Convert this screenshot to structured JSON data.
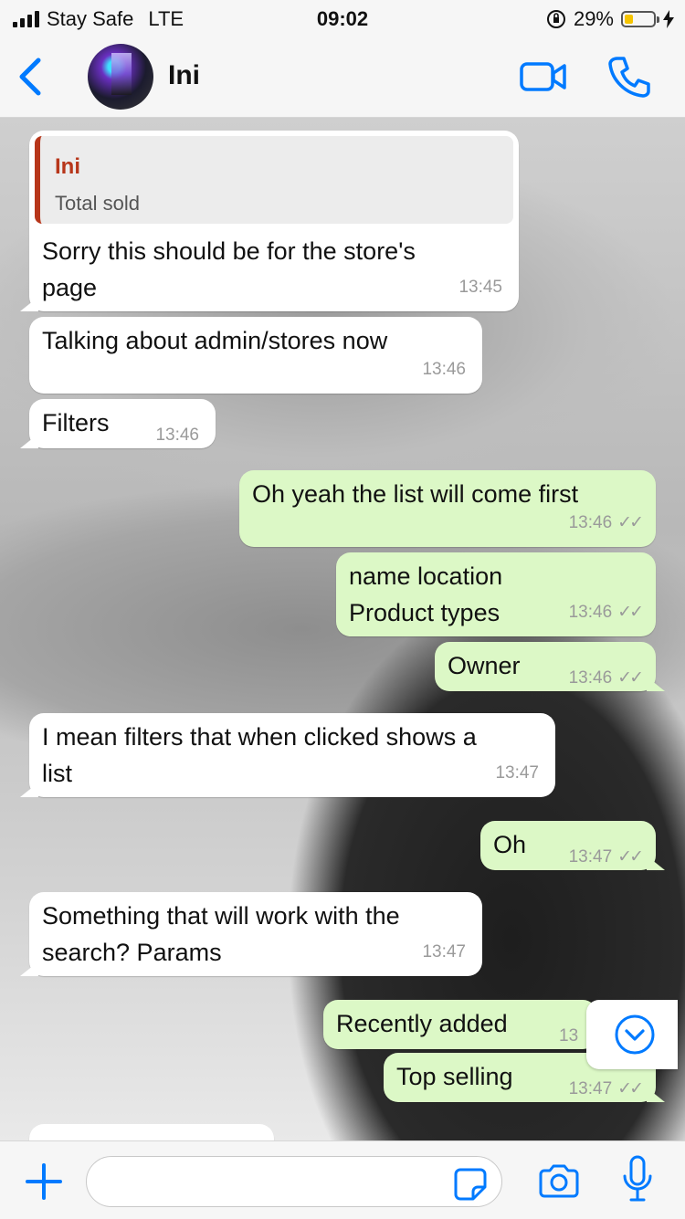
{
  "status_bar": {
    "carrier": "Stay Safe",
    "network": "LTE",
    "time": "09:02",
    "battery_percent": "29%",
    "battery_level": 0.29
  },
  "header": {
    "contact_name": "Ini",
    "back_icon": "chevron-left-icon",
    "video_icon": "video-camera-icon",
    "call_icon": "phone-icon"
  },
  "colors": {
    "accent": "#007aff",
    "outgoing_bubble": "#dcf8c6",
    "incoming_bubble": "#ffffff",
    "quote_name": "#b7361a"
  },
  "messages": [
    {
      "dir": "in",
      "quote_name": "Ini",
      "quote_text": "Total sold",
      "text": "Sorry this should be for the store's\npage",
      "time": "13:45"
    },
    {
      "dir": "in",
      "text": "Talking about admin/stores now",
      "time": "13:46"
    },
    {
      "dir": "in",
      "text": "Filters",
      "time": "13:46"
    },
    {
      "dir": "out",
      "text": "Oh yeah the list will come first",
      "time": "13:46",
      "ticks": "✓✓"
    },
    {
      "dir": "out",
      "text": "name location\nProduct types",
      "time": "13:46",
      "ticks": "✓✓"
    },
    {
      "dir": "out",
      "text": "Owner",
      "time": "13:46",
      "ticks": "✓✓"
    },
    {
      "dir": "in",
      "text": "I mean filters that when clicked shows a\nlist",
      "time": "13:47"
    },
    {
      "dir": "out",
      "text": "Oh",
      "time": "13:47",
      "ticks": "✓✓"
    },
    {
      "dir": "in",
      "text": "Something that will work with the\nsearch? Params",
      "time": "13:47"
    },
    {
      "dir": "out",
      "text": "Recently added",
      "time": "13"
    },
    {
      "dir": "out",
      "text": "Top selling",
      "time": "13:47",
      "ticks": "✓✓"
    }
  ],
  "input": {
    "value": "",
    "placeholder": ""
  }
}
